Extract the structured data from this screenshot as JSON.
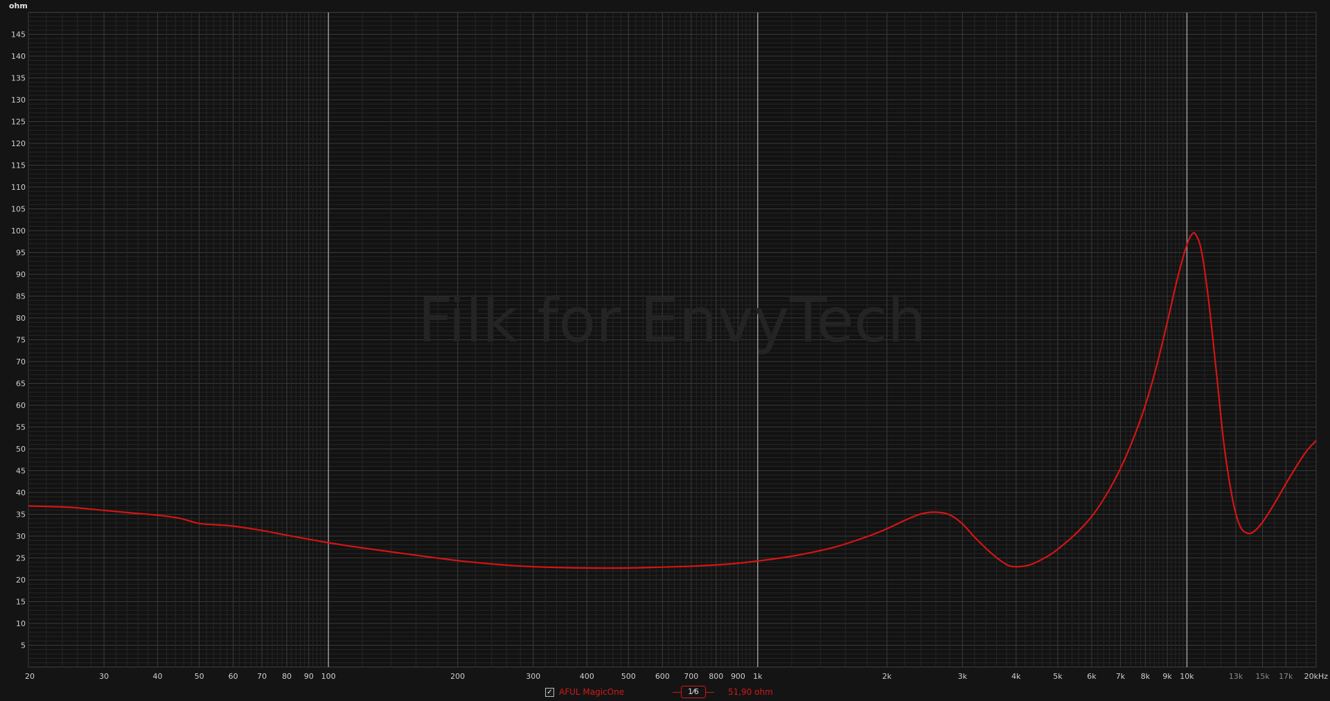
{
  "watermark": "Filk for EnvyTech",
  "colors": {
    "background": "#141414",
    "plot_bg": "#121212",
    "trace": "#d61414",
    "grid": "#3a3a3a",
    "grid_minor": "#262626",
    "decade": "#9a9a9a",
    "text": "#cfcfcf"
  },
  "legend": {
    "checked": true,
    "check_glyph": "✓",
    "name": "AFUL MagicOne",
    "smoothing": "1⁄6",
    "value": "51,90 ohm"
  },
  "chart_data": {
    "type": "line",
    "title": "",
    "xlabel": "",
    "ylabel": "ohm",
    "x_scale": "log",
    "xlim": [
      20,
      20000
    ],
    "ylim": [
      0,
      150
    ],
    "grid": true,
    "x_ticks": [
      {
        "v": 20,
        "label": "20"
      },
      {
        "v": 30,
        "label": "30"
      },
      {
        "v": 40,
        "label": "40"
      },
      {
        "v": 50,
        "label": "50"
      },
      {
        "v": 60,
        "label": "60"
      },
      {
        "v": 70,
        "label": "70"
      },
      {
        "v": 80,
        "label": "80"
      },
      {
        "v": 90,
        "label": "90"
      },
      {
        "v": 100,
        "label": "100"
      },
      {
        "v": 200,
        "label": "200"
      },
      {
        "v": 300,
        "label": "300"
      },
      {
        "v": 400,
        "label": "400"
      },
      {
        "v": 500,
        "label": "500"
      },
      {
        "v": 600,
        "label": "600"
      },
      {
        "v": 700,
        "label": "700"
      },
      {
        "v": 800,
        "label": "800"
      },
      {
        "v": 900,
        "label": "900"
      },
      {
        "v": 1000,
        "label": "1k"
      },
      {
        "v": 2000,
        "label": "2k"
      },
      {
        "v": 3000,
        "label": "3k"
      },
      {
        "v": 4000,
        "label": "4k"
      },
      {
        "v": 5000,
        "label": "5k"
      },
      {
        "v": 6000,
        "label": "6k"
      },
      {
        "v": 7000,
        "label": "7k"
      },
      {
        "v": 8000,
        "label": "8k"
      },
      {
        "v": 9000,
        "label": "9k"
      },
      {
        "v": 10000,
        "label": "10k"
      },
      {
        "v": 13000,
        "label": "13k"
      },
      {
        "v": 15000,
        "label": "15k"
      },
      {
        "v": 17000,
        "label": "17k"
      },
      {
        "v": 20000,
        "label": "20kHz"
      }
    ],
    "y_ticks": [
      5,
      10,
      15,
      20,
      25,
      30,
      35,
      40,
      45,
      50,
      55,
      60,
      65,
      70,
      75,
      80,
      85,
      90,
      95,
      100,
      105,
      110,
      115,
      120,
      125,
      130,
      135,
      140,
      145
    ],
    "series": [
      {
        "name": "AFUL MagicOne",
        "color": "#d61414",
        "points": [
          [
            20,
            36.9
          ],
          [
            25,
            36.6
          ],
          [
            30,
            35.9
          ],
          [
            35,
            35.3
          ],
          [
            40,
            34.8
          ],
          [
            45,
            34.1
          ],
          [
            50,
            32.9
          ],
          [
            55,
            32.6
          ],
          [
            60,
            32.3
          ],
          [
            70,
            31.3
          ],
          [
            80,
            30.2
          ],
          [
            90,
            29.3
          ],
          [
            100,
            28.5
          ],
          [
            120,
            27.3
          ],
          [
            150,
            26.0
          ],
          [
            200,
            24.4
          ],
          [
            250,
            23.5
          ],
          [
            300,
            23.0
          ],
          [
            400,
            22.7
          ],
          [
            500,
            22.7
          ],
          [
            600,
            22.9
          ],
          [
            700,
            23.1
          ],
          [
            800,
            23.4
          ],
          [
            900,
            23.8
          ],
          [
            1000,
            24.3
          ],
          [
            1200,
            25.4
          ],
          [
            1500,
            27.4
          ],
          [
            1800,
            29.9
          ],
          [
            2000,
            31.7
          ],
          [
            2200,
            33.6
          ],
          [
            2400,
            35.1
          ],
          [
            2600,
            35.5
          ],
          [
            2800,
            34.9
          ],
          [
            3000,
            32.8
          ],
          [
            3200,
            29.8
          ],
          [
            3500,
            26.1
          ],
          [
            3800,
            23.5
          ],
          [
            4000,
            23.0
          ],
          [
            4300,
            23.4
          ],
          [
            4700,
            25.2
          ],
          [
            5000,
            27.0
          ],
          [
            5500,
            30.5
          ],
          [
            6000,
            34.5
          ],
          [
            6500,
            39.6
          ],
          [
            7000,
            45.5
          ],
          [
            7500,
            52.3
          ],
          [
            8000,
            60.0
          ],
          [
            8500,
            69.0
          ],
          [
            9000,
            79.0
          ],
          [
            9500,
            89.0
          ],
          [
            10000,
            96.8
          ],
          [
            10300,
            99.3
          ],
          [
            10500,
            99.0
          ],
          [
            10800,
            95.5
          ],
          [
            11200,
            85.0
          ],
          [
            11700,
            68.0
          ],
          [
            12200,
            51.0
          ],
          [
            12800,
            38.0
          ],
          [
            13300,
            32.3
          ],
          [
            13800,
            30.7
          ],
          [
            14300,
            31.0
          ],
          [
            15000,
            33.2
          ],
          [
            16000,
            37.5
          ],
          [
            17000,
            42.0
          ],
          [
            18000,
            46.0
          ],
          [
            19000,
            49.5
          ],
          [
            20000,
            51.9
          ]
        ]
      }
    ]
  }
}
